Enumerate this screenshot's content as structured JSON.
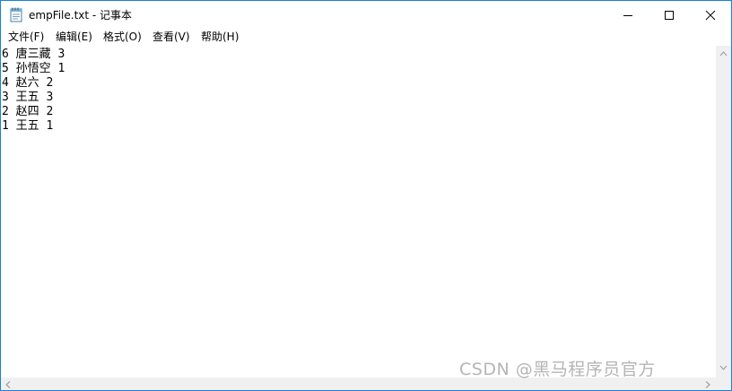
{
  "window": {
    "title": "empFile.txt - 记事本"
  },
  "menu": {
    "items": [
      {
        "label": "文件(F)"
      },
      {
        "label": "编辑(E)"
      },
      {
        "label": "格式(O)"
      },
      {
        "label": "查看(V)"
      },
      {
        "label": "帮助(H)"
      }
    ]
  },
  "content": {
    "lines": [
      "6 唐三藏 3",
      "5 孙悟空 1",
      "4 赵六 2",
      "3 王五 3",
      "2 赵四 2",
      "1 王五 1"
    ]
  },
  "watermark": {
    "text": "CSDN @黑马程序员官方"
  },
  "icons": {
    "app": "notepad-icon",
    "minimize": "minimize-icon",
    "maximize": "maximize-icon",
    "close": "close-icon"
  }
}
